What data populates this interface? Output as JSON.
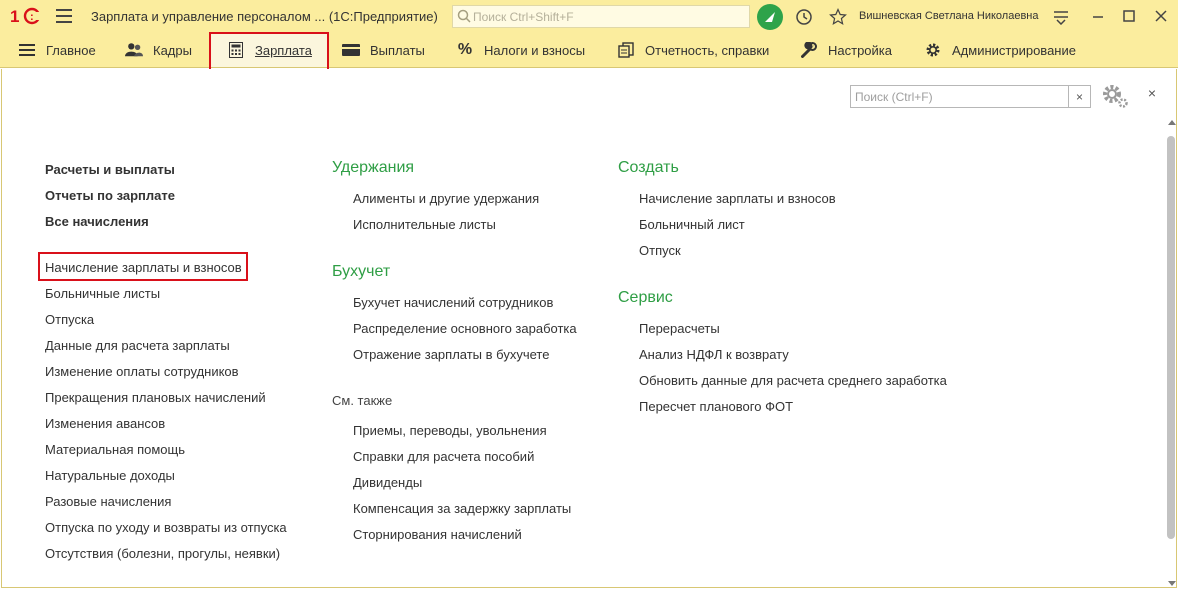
{
  "window": {
    "title": "Зарплата и управление персоналом ...  (1С:Предприятие)",
    "search_placeholder": "Поиск Ctrl+Shift+F",
    "user": "Вишневская Светлана Николаевна",
    "logo_text": "1С"
  },
  "sections": [
    {
      "label": "Главное",
      "icon": "menu-lines-icon"
    },
    {
      "label": "Кадры",
      "icon": "people-icon"
    },
    {
      "label": "Зарплата",
      "icon": "calculator-icon",
      "active": true
    },
    {
      "label": "Выплаты",
      "icon": "card-icon"
    },
    {
      "label": "Налоги и взносы",
      "icon": "percent-icon"
    },
    {
      "label": "Отчетность, справки",
      "icon": "reports-icon"
    },
    {
      "label": "Настройка",
      "icon": "wrench-icon"
    },
    {
      "label": "Администрирование",
      "icon": "gear-icon"
    }
  ],
  "panel": {
    "search_placeholder": "Поиск (Ctrl+F)",
    "clear_label": "×",
    "close_label": "×"
  },
  "col1": {
    "bold": [
      "Расчеты и выплаты",
      "Отчеты по зарплате",
      "Все начисления"
    ],
    "items": [
      "Начисление зарплаты и взносов",
      "Больничные листы",
      "Отпуска",
      "Данные для расчета зарплаты",
      "Изменение оплаты сотрудников",
      "Прекращения плановых начислений",
      "Изменения авансов",
      "Материальная помощь",
      "Натуральные доходы",
      "Разовые начисления",
      "Отпуска по уходу и возвраты из отпуска",
      "Отсутствия (болезни, прогулы, неявки)"
    ]
  },
  "col2": {
    "groups": [
      {
        "title": "Удержания",
        "items": [
          "Алименты и другие удержания",
          "Исполнительные листы"
        ]
      },
      {
        "title": "Бухучет",
        "items": [
          "Бухучет начислений сотрудников",
          "Распределение основного заработка",
          "Отражение зарплаты в бухучете"
        ]
      }
    ],
    "see_also": {
      "title": "См. также",
      "items": [
        "Приемы, переводы, увольнения",
        "Справки для расчета пособий",
        "Дивиденды",
        "Компенсация за задержку зарплаты",
        "Сторнирования начислений"
      ]
    }
  },
  "col3": {
    "groups": [
      {
        "title": "Создать",
        "items": [
          "Начисление зарплаты и взносов",
          "Больничный лист",
          "Отпуск"
        ]
      },
      {
        "title": "Сервис",
        "items": [
          "Перерасчеты",
          "Анализ НДФЛ к возврату",
          "Обновить данные для расчета среднего заработка",
          "Пересчет планового ФОТ"
        ]
      }
    ]
  },
  "colors": {
    "header_bg": "#fbed9e",
    "group_green": "#2f9e45",
    "highlight_red": "#d9101a",
    "notify_green": "#2ea34a"
  }
}
